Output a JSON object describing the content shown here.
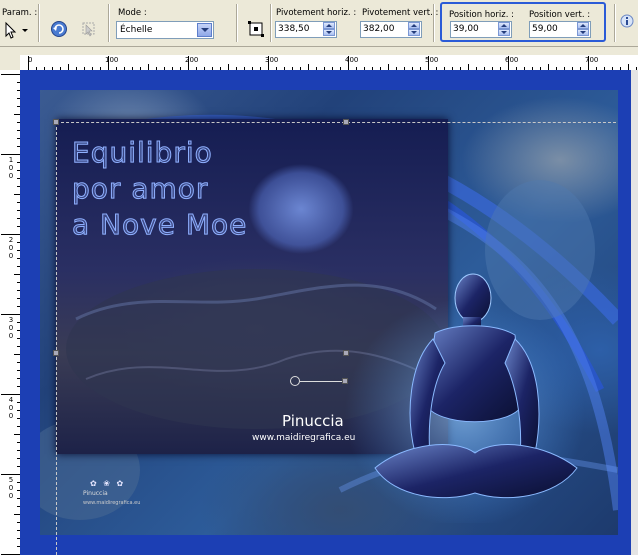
{
  "toolbar": {
    "param_label": "Param. :",
    "mode_label": "Mode :",
    "mode_value": "Échelle",
    "fields": [
      {
        "label": "Pivotement horiz. :",
        "value": "338,50"
      },
      {
        "label": "Pivotement vert. :",
        "value": "382,00"
      },
      {
        "label": "Position horiz. :",
        "value": "39,00"
      },
      {
        "label": "Position vert. :",
        "value": "59,00"
      }
    ]
  },
  "ruler_h": [
    "0",
    "100",
    "200",
    "300",
    "400",
    "500",
    "600",
    "700"
  ],
  "ruler_v": [
    {
      "digits": [
        "1",
        "0",
        "0"
      ]
    },
    {
      "digits": [
        "2",
        "0",
        "0"
      ]
    },
    {
      "digits": [
        "3",
        "0",
        "0"
      ]
    },
    {
      "digits": [
        "4",
        "0",
        "0"
      ]
    },
    {
      "digits": [
        "5",
        "0",
        "0"
      ]
    }
  ],
  "image": {
    "title_lines": [
      "Equilibrio",
      "por amor",
      "a Nove Moe"
    ],
    "signature_name": "Pinuccia",
    "signature_url": "www.maidiregrafica.eu",
    "watermark_name": "Pinuccia",
    "watermark_url": "www.maidiregrafica.eu"
  }
}
